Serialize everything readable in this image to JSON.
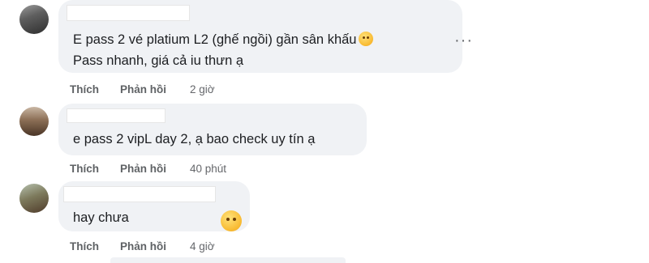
{
  "comments": [
    {
      "lines": [
        "E pass 2 vé platium L2 (ghế ngồi) gần sân khấu",
        "Pass nhanh, giá cả iu thưn ạ"
      ],
      "like_label": "Thích",
      "reply_label": "Phản hồi",
      "time": "2 giờ"
    },
    {
      "lines": [
        "e pass 2 vipL day 2, ạ bao check uy tín ạ"
      ],
      "like_label": "Thích",
      "reply_label": "Phản hồi",
      "time": "40 phút"
    },
    {
      "lines": [
        "hay chưa"
      ],
      "like_label": "Thích",
      "reply_label": "Phản hồi",
      "time": "4 giờ"
    }
  ],
  "more_options_symbol": "···",
  "colors": {
    "bubble": "#f0f2f5",
    "text": "#1c1e21",
    "meta": "#65676b"
  },
  "icons": [
    "sad-face-emoji-icon",
    "more-options-icon"
  ]
}
